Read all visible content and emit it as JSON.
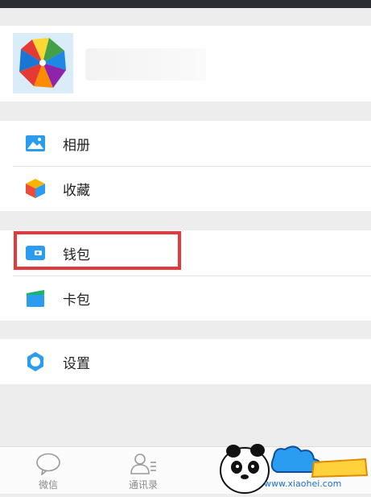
{
  "menu": {
    "album": "相册",
    "favorites": "收藏",
    "wallet": "钱包",
    "card_package": "卡包",
    "settings": "设置"
  },
  "tabs": {
    "wechat": "微信",
    "contacts": "通讯录"
  },
  "watermark": {
    "url": "www.xiaohei.com"
  },
  "colors": {
    "accent": "#2b9df0",
    "highlight": "#e5393b"
  },
  "icons": [
    "album-icon",
    "favorites-icon",
    "wallet-icon",
    "card-package-icon",
    "settings-icon",
    "chat-icon",
    "contacts-icon"
  ]
}
